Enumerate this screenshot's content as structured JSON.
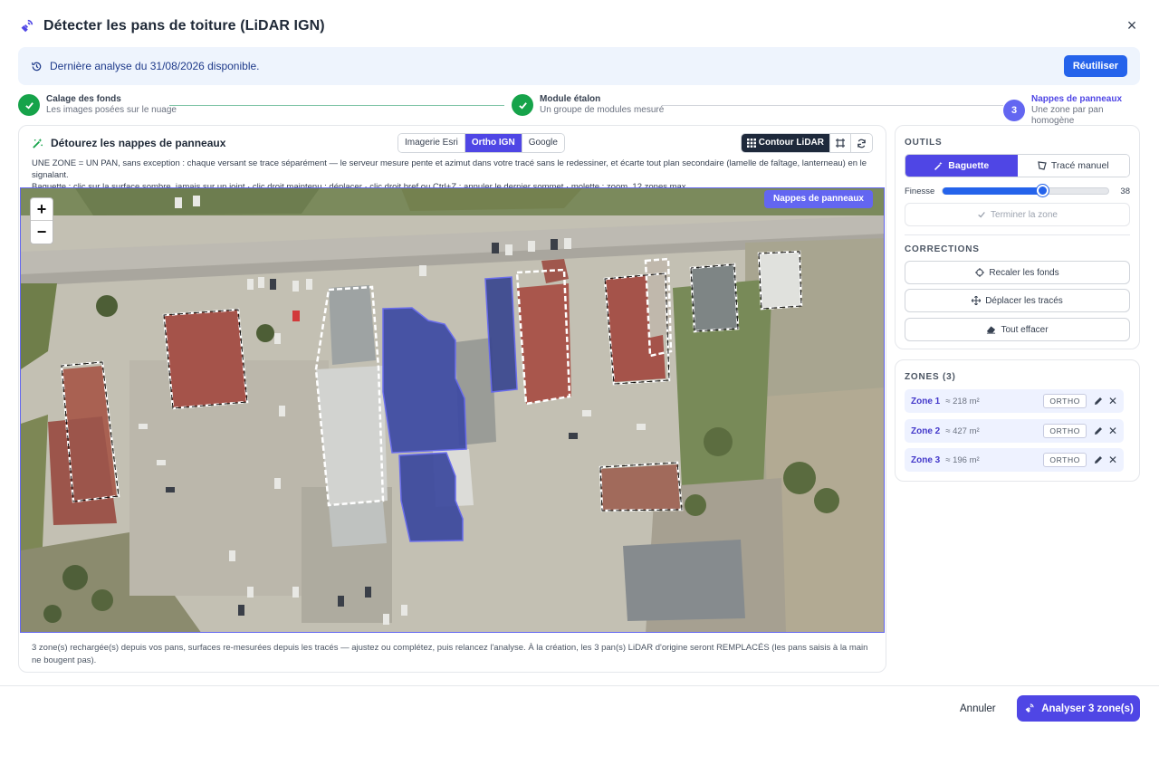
{
  "dialog": {
    "title": "Détecter les pans de toiture (LiDAR IGN)",
    "close_label": "×"
  },
  "banner": {
    "text": "Dernière analyse du 31/08/2026 disponible.",
    "reuse_label": "Réutiliser"
  },
  "steps": [
    {
      "title": "Calage des fonds",
      "subtitle": "Les images posées sur le nuage",
      "state": "done"
    },
    {
      "title": "Module étalon",
      "subtitle": "Un groupe de modules mesuré",
      "state": "done"
    },
    {
      "number": "3",
      "title": "Nappes de panneaux",
      "subtitle": "Une zone par pan homogène",
      "state": "active"
    }
  ],
  "panel": {
    "title": "Détourez les nappes de panneaux",
    "sources": [
      "Imagerie Esri",
      "Ortho IGN",
      "Google"
    ],
    "selected_source": "Ortho IGN",
    "contour_label": "Contour LiDAR",
    "description_1": "UNE ZONE = UN PAN, sans exception : chaque versant se trace séparément — le serveur mesure pente et azimut dans votre tracé sans le redessiner, et écarte tout plan secondaire (lamelle de faîtage, lanterneau) en le signalant.",
    "description_2": "Baguette : clic sur la surface sombre, jamais sur un joint · clic droit maintenu : déplacer · clic droit bref ou Ctrl+Z : annuler le dernier sommet · molette : zoom. 12 zones max.",
    "map_badge": "Nappes de panneaux",
    "zoom_in": "+",
    "zoom_out": "−",
    "footer_note": "3 zone(s) rechargée(s) depuis vos pans, surfaces re-mesurées depuis les tracés — ajustez ou complétez, puis relancez l'analyse. À la création, les 3 pan(s) LiDAR d'origine seront REMPLACÉS (les pans saisis à la main ne bougent pas)."
  },
  "tools": {
    "section_label": "OUTILS",
    "tab_wand": "Baguette",
    "tab_manual": "Tracé manuel",
    "finesse_label": "Finesse",
    "finesse_value": "38",
    "finesse_fraction": 0.6,
    "finish_label": "Terminer la zone",
    "corrections_label": "CORRECTIONS",
    "recalibrate_label": "Recaler les fonds",
    "move_label": "Déplacer les tracés",
    "clear_label": "Tout effacer"
  },
  "zones": {
    "section_label": "ZONES (3)",
    "items": [
      {
        "name": "Zone 1",
        "area": "≈ 218 m²",
        "tag": "ORTHO"
      },
      {
        "name": "Zone 2",
        "area": "≈ 427 m²",
        "tag": "ORTHO"
      },
      {
        "name": "Zone 3",
        "area": "≈ 196 m²",
        "tag": "ORTHO"
      }
    ]
  },
  "footer": {
    "cancel_label": "Annuler",
    "analyse_label": "Analyser 3 zone(s)"
  },
  "colors": {
    "accent": "#4f46e5",
    "success": "#16a34a",
    "banner_bg": "#eef4fd",
    "primary_blue": "#2563eb"
  }
}
